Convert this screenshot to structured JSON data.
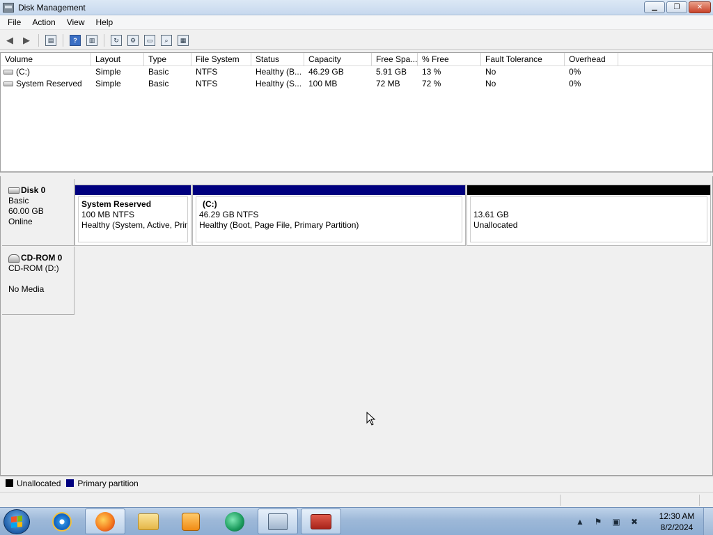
{
  "window": {
    "title": "Disk Management"
  },
  "menu": {
    "items": [
      "File",
      "Action",
      "View",
      "Help"
    ]
  },
  "volumes": {
    "columns": [
      "Volume",
      "Layout",
      "Type",
      "File System",
      "Status",
      "Capacity",
      "Free Spa...",
      "% Free",
      "Fault Tolerance",
      "Overhead"
    ],
    "rows": [
      [
        "(C:)",
        "Simple",
        "Basic",
        "NTFS",
        "Healthy (B...",
        "46.29 GB",
        "5.91 GB",
        "13 %",
        "No",
        "0%"
      ],
      [
        "System Reserved",
        "Simple",
        "Basic",
        "NTFS",
        "Healthy (S...",
        "100 MB",
        "72 MB",
        "72 %",
        "No",
        "0%"
      ]
    ]
  },
  "disks": {
    "disk0": {
      "name": "Disk 0",
      "type": "Basic",
      "size": "60.00 GB",
      "status": "Online",
      "partitions": [
        {
          "name": "System Reserved",
          "size": "100 MB NTFS",
          "status": "Healthy (System, Active, Primary Partition)",
          "kind": "primary"
        },
        {
          "name": "(C:)",
          "size": "46.29 GB NTFS",
          "status": "Healthy (Boot, Page File, Primary Partition)",
          "kind": "primary"
        },
        {
          "name": "",
          "size": "13.61 GB",
          "status": "Unallocated",
          "kind": "unallocated"
        }
      ]
    },
    "cdrom0": {
      "name": "CD-ROM 0",
      "drive": "CD-ROM (D:)",
      "status": "No Media"
    }
  },
  "legend": {
    "unallocated": "Unallocated",
    "primary": "Primary partition"
  },
  "colors": {
    "primary": "#00007f",
    "unallocated": "#000000"
  },
  "taskbar": {
    "time": "12:30 AM",
    "date": "8/2/2024"
  }
}
